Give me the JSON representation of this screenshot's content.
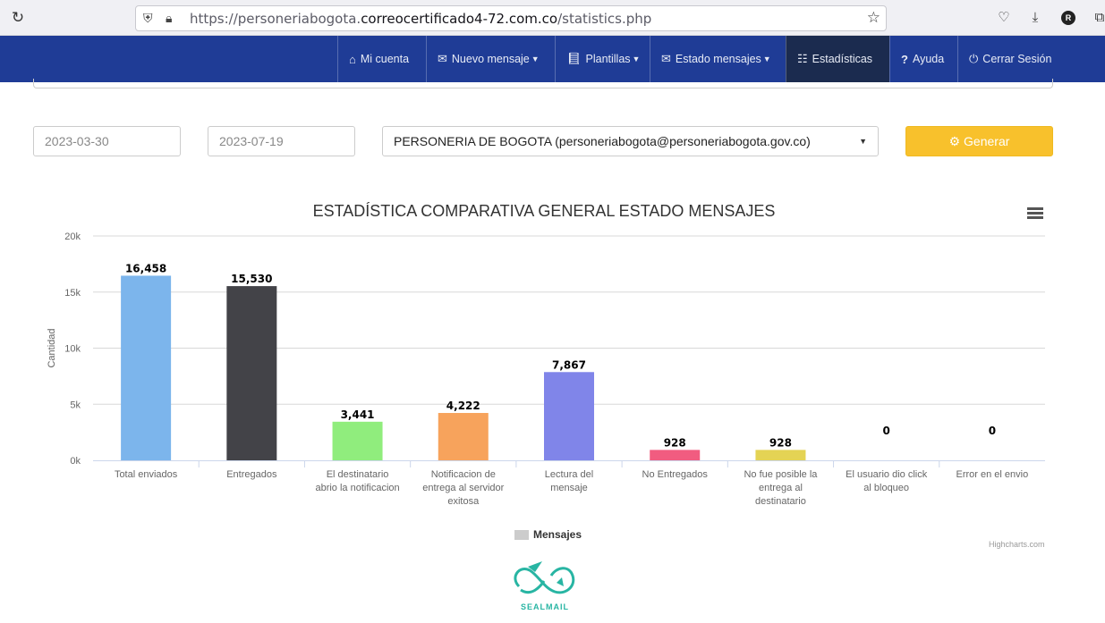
{
  "browser": {
    "url_prefix": "https://personeriabogota.",
    "url_host": "correocertificado4-72.com.co",
    "url_suffix": "/statistics.php",
    "avatar_letter": "R"
  },
  "navbar": {
    "items": [
      {
        "label": "Mi cuenta",
        "icon": "home-icon"
      },
      {
        "label": "Nuevo mensaje",
        "icon": "envelope-icon",
        "caret": true
      },
      {
        "label": "Plantillas",
        "icon": "book-icon",
        "caret": true
      },
      {
        "label": "Estado mensajes",
        "icon": "envelope-icon",
        "caret": true
      },
      {
        "label": "Estadísticas",
        "icon": "bar-chart-icon",
        "active": true
      },
      {
        "label": "Ayuda",
        "icon": "question-icon"
      },
      {
        "label": "Cerrar Sesión",
        "icon": "power-icon"
      }
    ]
  },
  "filters": {
    "date_from": "2023-03-30",
    "date_to": "2023-07-19",
    "account": "PERSONERIA DE BOGOTA (personeriabogota@personeriabogota.gov.co)",
    "generate_label": "Generar"
  },
  "chart_data": {
    "type": "bar",
    "title": "ESTADÍSTICA COMPARATIVA GENERAL ESTADO MENSAJES",
    "ylabel": "Cantidad",
    "ylim": [
      0,
      20000
    ],
    "yticks": [
      "0k",
      "5k",
      "10k",
      "15k",
      "20k"
    ],
    "grid": true,
    "legend_position": "bottom-center",
    "categories": [
      [
        "Total enviados"
      ],
      [
        "Entregados"
      ],
      [
        "El destinatario",
        "abrio la notificacion"
      ],
      [
        "Notificacion de",
        "entrega al servidor",
        "exitosa"
      ],
      [
        "Lectura del",
        "mensaje"
      ],
      [
        "No Entregados"
      ],
      [
        "No fue posible la",
        "entrega al",
        "destinatario"
      ],
      [
        "El usuario dio click",
        "al bloqueo"
      ],
      [
        "Error en el envio"
      ]
    ],
    "series": [
      {
        "name": "Mensajes",
        "values": [
          16458,
          15530,
          3441,
          4222,
          7867,
          928,
          928,
          0,
          0
        ],
        "labels": [
          "16,458",
          "15,530",
          "3,441",
          "4,222",
          "7,867",
          "928",
          "928",
          "0",
          "0"
        ],
        "colors": [
          "#7cb5ec",
          "#434348",
          "#90ed7d",
          "#f7a35c",
          "#8085e9",
          "#f15c80",
          "#e4d354",
          "#2b908f",
          "#f45b5b"
        ]
      }
    ],
    "credits": "Highcharts.com"
  },
  "footer": {
    "logo_text": "SEALMAIL"
  }
}
